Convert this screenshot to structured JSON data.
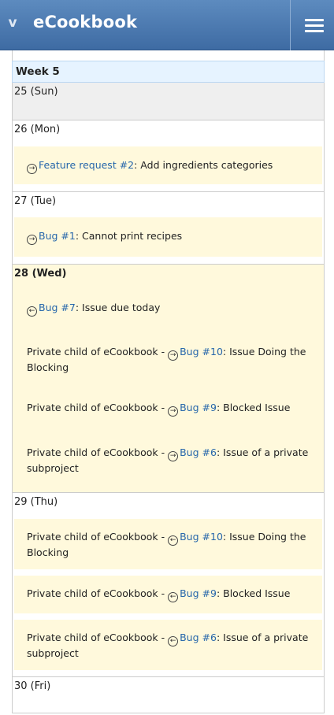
{
  "header": {
    "title": "eCookbook",
    "toggle_glyph": "v",
    "menu_icon": "hamburger-icon"
  },
  "week": {
    "label": "Week 5"
  },
  "days": [
    {
      "label": "25 (Sun)",
      "issues": []
    },
    {
      "label": "26 (Mon)",
      "issues": [
        {
          "prefix": "",
          "arrow": "→",
          "link": "Feature request #2",
          "text": ": Add ingredients categories"
        }
      ]
    },
    {
      "label": "27 (Tue)",
      "issues": [
        {
          "prefix": "",
          "arrow": "→",
          "link": "Bug #1",
          "text": ": Cannot print recipes"
        }
      ]
    },
    {
      "label": "28 (Wed)",
      "issues": [
        {
          "prefix": "",
          "arrow": "←",
          "link": "Bug #7",
          "text": ": Issue due today"
        },
        {
          "prefix": "Private child of eCookbook - ",
          "arrow": "→",
          "link": "Bug #10",
          "text": ": Issue Doing the Blocking"
        },
        {
          "prefix": "Private child of eCookbook - ",
          "arrow": "→",
          "link": "Bug #9",
          "text": ": Blocked Issue"
        },
        {
          "prefix": "Private child of eCookbook - ",
          "arrow": "→",
          "link": "Bug #6",
          "text": ": Issue of a private subproject"
        }
      ]
    },
    {
      "label": "29 (Thu)",
      "issues": [
        {
          "prefix": "Private child of eCookbook - ",
          "arrow": "←",
          "link": "Bug #10",
          "text": ": Issue Doing the Blocking"
        },
        {
          "prefix": "Private child of eCookbook - ",
          "arrow": "←",
          "link": "Bug #9",
          "text": ": Blocked Issue"
        },
        {
          "prefix": "Private child of eCookbook - ",
          "arrow": "←",
          "link": "Bug #6",
          "text": ": Issue of a private subproject"
        }
      ]
    },
    {
      "label": "30 (Fri)",
      "issues": []
    }
  ]
}
